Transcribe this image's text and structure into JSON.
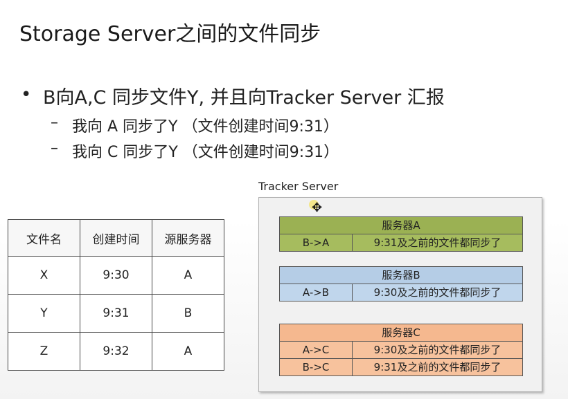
{
  "title": "Storage Server之间的文件同步",
  "bullet": {
    "symbol": "•",
    "text": "B向A,C 同步文件Y, 并且向Tracker Server 汇报",
    "subitems": [
      {
        "dash": "–",
        "text": "我向 A 同步了Y （文件创建时间9:31）"
      },
      {
        "dash": "–",
        "text": "我向 C 同步了Y （文件创建时间9:31）"
      }
    ]
  },
  "table": {
    "headers": [
      "文件名",
      "创建时间",
      "源服务器"
    ],
    "rows": [
      [
        "X",
        "9:30",
        "A"
      ],
      [
        "Y",
        "9:31",
        "B"
      ],
      [
        "Z",
        "9:32",
        "A"
      ]
    ]
  },
  "tracker": {
    "label": "Tracker Server",
    "servers": [
      {
        "name": "服务器A",
        "color": "#9bb153",
        "rows": [
          [
            "B->A",
            "9:31及之前的文件都同步了"
          ]
        ]
      },
      {
        "name": "服务器B",
        "color": "#b5cde6",
        "rows": [
          [
            "A->B",
            "9:30及之前的文件都同步了"
          ]
        ]
      },
      {
        "name": "服务器C",
        "color": "#f5b88f",
        "rows": [
          [
            "A->C",
            "9:30及之前的文件都同步了"
          ],
          [
            "B->C",
            "9:31及之前的文件都同步了"
          ]
        ]
      }
    ]
  },
  "cursor": {
    "icon": "move-cursor-icon",
    "glyph": "✥"
  }
}
